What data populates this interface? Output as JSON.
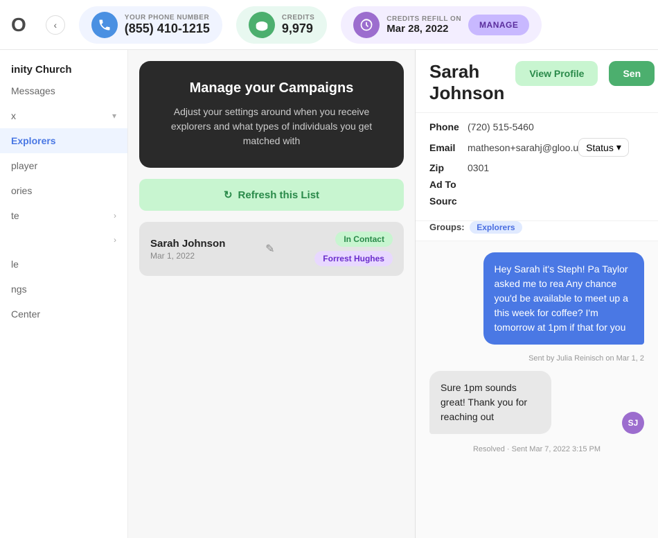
{
  "topbar": {
    "logo": "O",
    "back_label": "‹",
    "phone": {
      "label": "YOUR PHONE NUMBER",
      "number": "(855) 410-1215"
    },
    "credits": {
      "label": "CREDITS",
      "value": "9,979"
    },
    "refill": {
      "label": "CREDITS REFILL ON",
      "date": "Mar 28, 2022",
      "manage_label": "MANAGE"
    }
  },
  "sidebar": {
    "org": "inity Church",
    "items": [
      {
        "label": "Messages",
        "active": false,
        "arrow": ""
      },
      {
        "label": "Explorers",
        "active": true,
        "arrow": ""
      },
      {
        "label": "layer",
        "active": false,
        "arrow": ""
      },
      {
        "label": "ories",
        "active": false,
        "arrow": ""
      },
      {
        "label": "te",
        "active": false,
        "arrow": ">"
      },
      {
        "label": "",
        "active": false,
        "arrow": ">"
      },
      {
        "label": "le",
        "active": false,
        "arrow": ""
      },
      {
        "label": "ngs",
        "active": false,
        "arrow": ""
      },
      {
        "label": "Center",
        "active": false,
        "arrow": ""
      }
    ]
  },
  "campaign": {
    "title": "Manage your Campaigns",
    "description": "Adjust your settings around when you receive explorers and what types of individuals you get matched with"
  },
  "refresh_btn": "Refresh this List",
  "contact": {
    "name": "Sarah Johnson",
    "date": "Mar 1, 2022",
    "badge_status": "In Contact",
    "badge_agent": "Forrest Hughes"
  },
  "profile": {
    "name": "Sarah\nJohnson",
    "name_line1": "Sarah",
    "name_line2": "Johnson",
    "view_profile_label": "View Profile",
    "send_label": "Sen",
    "phone": "(720) 515-5460",
    "email": "matheson+sarahj@gloo.u",
    "status": "Status",
    "zip": "0301",
    "ad_to": "Ad To",
    "source": "Sourc",
    "groups_label": "Groups:",
    "groups_value": "Explorers"
  },
  "messages": [
    {
      "type": "out",
      "text": "Hey Sarah it's Steph! Pa Taylor asked me to rea Any chance you'd be available to meet up a this week for coffee? I'm tomorrow at 1pm if that for you",
      "meta": "Sent by Julia Reinisch on Mar 1, 2"
    },
    {
      "type": "in",
      "text": "Sure 1pm sounds great! Thank you for reaching out",
      "meta": "Resolved · Sent Mar 7, 2022 3:15 PM",
      "avatar": "SJ"
    }
  ]
}
